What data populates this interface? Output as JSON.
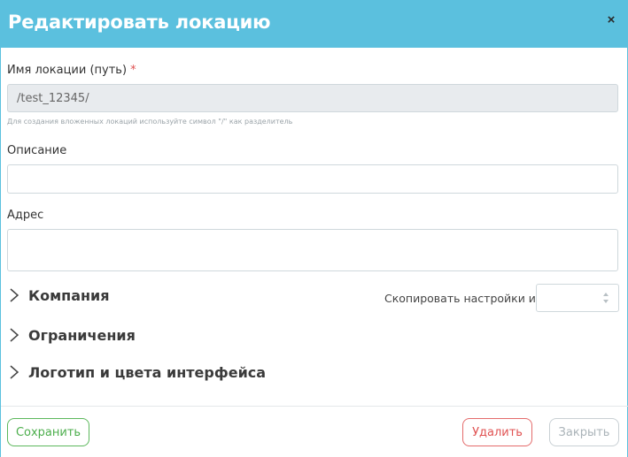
{
  "header": {
    "title": "Редактировать локацию",
    "close_glyph": "×"
  },
  "form": {
    "location_name": {
      "label": "Имя локации (путь)",
      "required_mark": "*",
      "value": "/test_12345/",
      "hint": "Для создания вложенных локаций используйте символ \"/\" как разделитель"
    },
    "description": {
      "label": "Описание",
      "value": ""
    },
    "address": {
      "label": "Адрес",
      "value": ""
    }
  },
  "sections": {
    "company": "Компания",
    "limits": "Ограничения",
    "logo_colors": "Логотип и цвета интерфейса"
  },
  "copy_settings": {
    "label": "Скопировать настройки из",
    "selected": ""
  },
  "footer": {
    "save_label": "Сохранить",
    "delete_label": "Удалить",
    "close_label": "Закрыть"
  },
  "icons": {
    "close": "close-icon",
    "section_chevron": "chevron-right-icon",
    "select_arrows": "sort-arrows-icon"
  },
  "colors": {
    "header_bg": "#5bc0de",
    "save": "#5cb85c",
    "delete": "#e05252",
    "close_disabled": "#aab3b8",
    "required": "#e05252"
  }
}
